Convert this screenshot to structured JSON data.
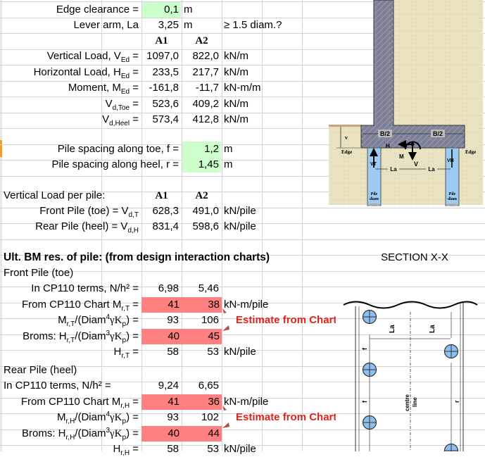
{
  "inputs": {
    "edge_clearance": {
      "label": "Edge clearance =",
      "value": "0,1",
      "unit": "m"
    },
    "lever_arm": {
      "label": "Lever arm, La",
      "value": "3,25",
      "unit": "m",
      "note": "≥ 1.5 diam.?"
    }
  },
  "columns": {
    "a1": "A1",
    "a2": "A2"
  },
  "loads": [
    {
      "label": "Vertical Load, V",
      "sub": "Ed",
      "suffix": " =",
      "a1": "1097,0",
      "a2": "822,0",
      "unit": "kN/m"
    },
    {
      "label": "Horizontal Load, H",
      "sub": "Ed",
      "suffix": " =",
      "a1": "233,5",
      "a2": "217,7",
      "unit": "kN/m"
    },
    {
      "label": "Moment, M",
      "sub": "Ed",
      "suffix": " =",
      "a1": "-161,8",
      "a2": "-11,7",
      "unit": "kN-m/m"
    },
    {
      "label": "V",
      "sub": "d,Toe",
      "suffix": " =",
      "a1": "523,6",
      "a2": "409,2",
      "unit": "kN/m"
    },
    {
      "label": "V",
      "sub": "d,Heel",
      "suffix": " =",
      "a1": "573,4",
      "a2": "412,8",
      "unit": "kN/m"
    }
  ],
  "spacing": {
    "toe": {
      "label": "Pile spacing along toe, f =",
      "value": "1,2",
      "unit": "m"
    },
    "heel": {
      "label": "Pile spacing along heel, r =",
      "value": "1,45",
      "unit": "m"
    }
  },
  "per_pile": {
    "heading": "Vertical Load per pile:",
    "rows": [
      {
        "label": "Front Pile (toe) = V",
        "sub": "d,T",
        "a1": "628,3",
        "a2": "491,0",
        "unit": "kN/pile"
      },
      {
        "label": "Rear Pile (heel) = V",
        "sub": "d,H",
        "a1": "831,4",
        "a2": "598,6",
        "unit": "kN/pile"
      }
    ]
  },
  "ult": {
    "heading": "Ult. BM res. of pile: (from design interaction charts)",
    "estimate_note": "Estimate from Chart",
    "front": {
      "title": "Front Pile (toe)",
      "cp110_terms": {
        "label": "In CP110 terms, N/h² =",
        "a1": "6,98",
        "a2": "5,46"
      },
      "chart_m": {
        "label": "From CP110 Chart  M",
        "sub": "r,T",
        "suffix": " =",
        "a1": "41",
        "a2": "38",
        "unit": "kN-m/pile"
      },
      "m_ratio": {
        "label": "M",
        "sub": "r,T",
        "mid": "/(Diam",
        "sup": "4",
        "tail": "γK",
        "sub2": "p",
        "end": ") =",
        "a1": "93",
        "a2": "106"
      },
      "broms": {
        "label": "Broms:  H",
        "sub": "r,T",
        "mid": "/(Diam",
        "sup": "3",
        "tail": "γK",
        "sub2": "p",
        "end": ") =",
        "a1": "40",
        "a2": "45"
      },
      "h": {
        "label": "H",
        "sub": "r,T",
        "suffix": " =",
        "a1": "58",
        "a2": "53",
        "unit": "kN/pile"
      }
    },
    "rear": {
      "title": "Rear Pile (heel)",
      "cp110_terms": {
        "label": "In CP110 terms, N/h² =",
        "a1": "9,24",
        "a2": "6,65"
      },
      "chart_m": {
        "label": "From CP110 Chart M",
        "sub": "r,H",
        "suffix": " =",
        "a1": "41",
        "a2": "36",
        "unit": "kN-m/pile"
      },
      "m_ratio": {
        "label": "M",
        "sub": "r,H",
        "mid": "/(Diam",
        "sup": "4",
        "tail": "γK",
        "sub2": "p",
        "end": ") =",
        "a1": "93",
        "a2": "102"
      },
      "broms": {
        "label": "Broms:  H",
        "sub": "r,H",
        "mid": "/(Diam",
        "sup": "3",
        "tail": "γK",
        "sub2": "p",
        "end": ") =",
        "a1": "40",
        "a2": "44"
      },
      "h": {
        "label": "H",
        "sub": "r,H",
        "suffix": " =",
        "a1": "58",
        "a2": "53",
        "unit": "kN/pile"
      }
    }
  },
  "diagram": {
    "section_title": "SECTION X-X",
    "labels": {
      "half_b": "B/2",
      "h": "H",
      "m": "M",
      "v": "V",
      "v_small": "v",
      "edge": "Edge",
      "vt": "VT",
      "vh": "VH",
      "la": "La",
      "pile_diam_1": "Pile",
      "pile_diam_2": "diam"
    },
    "plan_labels": {
      "la": "La",
      "f": "f",
      "r": "r",
      "centre": "centre",
      "line": "line"
    },
    "colors": {
      "concrete": "#7b7f96",
      "soil": "#e8e2c0",
      "pile": "#9ecbf2",
      "pile_circle": "#8dc0ef"
    }
  },
  "colors": {
    "input_green": "#ccffcc",
    "chart_pink": "#ff8080",
    "note_red": "#e0231c"
  }
}
